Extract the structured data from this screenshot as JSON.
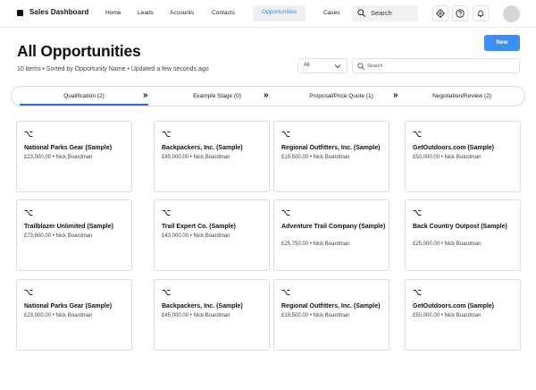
{
  "app": {
    "title": "Sales Dashboard"
  },
  "nav": {
    "items": [
      {
        "label": "Home"
      },
      {
        "label": "Leads"
      },
      {
        "label": "Accounts"
      },
      {
        "label": "Contacts"
      },
      {
        "label": "Opportunities",
        "active": true
      },
      {
        "label": "Cases"
      }
    ],
    "search_label": "Search",
    "icons": [
      "gear-icon",
      "help-icon",
      "bell-icon"
    ]
  },
  "header": {
    "title": "All Opportunities",
    "subtitle": "10 items • Sorted by Opportunity Name • Updated a few seconds ago",
    "new_label": "New",
    "filter_value": "All",
    "search_placeholder": "Search"
  },
  "stages": [
    {
      "label": "Qualification (2)",
      "active": true
    },
    {
      "label": "Example Stage (0)",
      "active": false
    },
    {
      "label": "Proposal/Price Quote (1)",
      "active": false
    },
    {
      "label": "Negotiation/Review (2)",
      "active": false
    }
  ],
  "cards": [
    {
      "name": "National Parks Gear (Sample)",
      "meta": "£23,000.00 • Nick Boardman"
    },
    {
      "name": "Backpackers, Inc. (Sample)",
      "meta": "£45,000.00 • Nick Boardman"
    },
    {
      "name": "Regional Outfitters, Inc. (Sample)",
      "meta": "£19,500.00 • Nick Boardman"
    },
    {
      "name": "GetOutdoors.com (Sample)",
      "meta": "£50,000.00 • Nick Boardman"
    },
    {
      "name": "Trailblazer Unlimited (Sample)",
      "meta": "£73,600.00 • Nick Boardman"
    },
    {
      "name": "Trail Expert Co. (Sample)",
      "meta": "£43,000.00 • Nick Boardman"
    },
    {
      "name": "Adventure Trail Company (Sample)",
      "meta": "£25,750.00 • Nick Boardman"
    },
    {
      "name": "Back Country Outpost (Sample)",
      "meta": "£25,000.00 • Nick Boardman"
    },
    {
      "name": "National Parks Gear (Sample)",
      "meta": "£23,000.00 • Nick Boardman"
    },
    {
      "name": "Backpackers, Inc. (Sample)",
      "meta": "£45,000.00 • Nick Boardman"
    },
    {
      "name": "Regional Outfitters, Inc. (Sample)",
      "meta": "£19,500.00 • Nick Boardman"
    },
    {
      "name": "GetOutdoors.com (Sample)",
      "meta": "£50,000.00 • Nick Boardman"
    }
  ],
  "colors": {
    "accent": "#3a8ef5",
    "active_nav_text": "#3f87d8",
    "stage_underline": "#2c6fd3"
  }
}
